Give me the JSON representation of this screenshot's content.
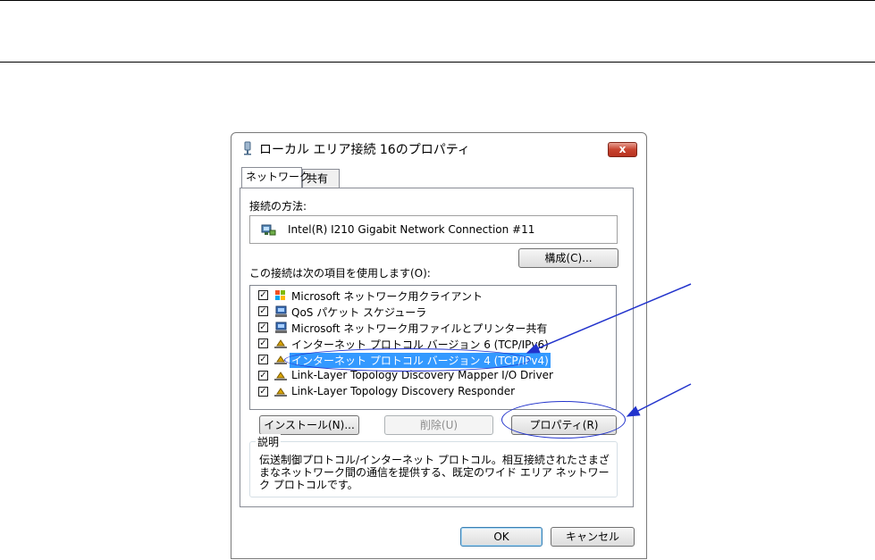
{
  "window": {
    "title": "ローカル エリア接続 16のプロパティ",
    "close_label": "x"
  },
  "tabs": [
    {
      "label": "ネットワーク"
    },
    {
      "label": "共有"
    }
  ],
  "connection": {
    "label": "接続の方法:",
    "adapter": "Intel(R) I210 Gigabit Network Connection #11",
    "configure_label": "構成(C)..."
  },
  "items": {
    "label": "この接続は次の項目を使用します(O):",
    "list": [
      {
        "label": "Microsoft ネットワーク用クライアント",
        "checked": true,
        "icon": "network-client-icon"
      },
      {
        "label": "QoS パケット スケジューラ",
        "checked": true,
        "icon": "qos-icon"
      },
      {
        "label": "Microsoft ネットワーク用ファイルとプリンター共有",
        "checked": true,
        "icon": "file-share-icon"
      },
      {
        "label": "インターネット プロトコル バージョン 6 (TCP/IPv6)",
        "checked": true,
        "icon": "protocol-icon"
      },
      {
        "label": "インターネット プロトコル バージョン 4 (TCP/IPv4)",
        "checked": true,
        "icon": "protocol-icon",
        "selected": true
      },
      {
        "label": "Link-Layer Topology Discovery Mapper I/O Driver",
        "checked": true,
        "icon": "protocol-icon"
      },
      {
        "label": "Link-Layer Topology Discovery Responder",
        "checked": true,
        "icon": "protocol-icon"
      }
    ]
  },
  "buttons": {
    "install": "インストール(N)...",
    "uninstall": "削除(U)",
    "properties": "プロパティ(R)"
  },
  "description": {
    "title": "説明",
    "text": "伝送制御プロトコル/インターネット プロトコル。相互接続されたさまざまなネットワーク間の通信を提供する、既定のワイド エリア ネットワーク プロトコルです。"
  },
  "footer": {
    "ok": "OK",
    "cancel": "キャンセル"
  },
  "colors": {
    "selection": "#3399ff",
    "annotation": "#2233cc"
  }
}
